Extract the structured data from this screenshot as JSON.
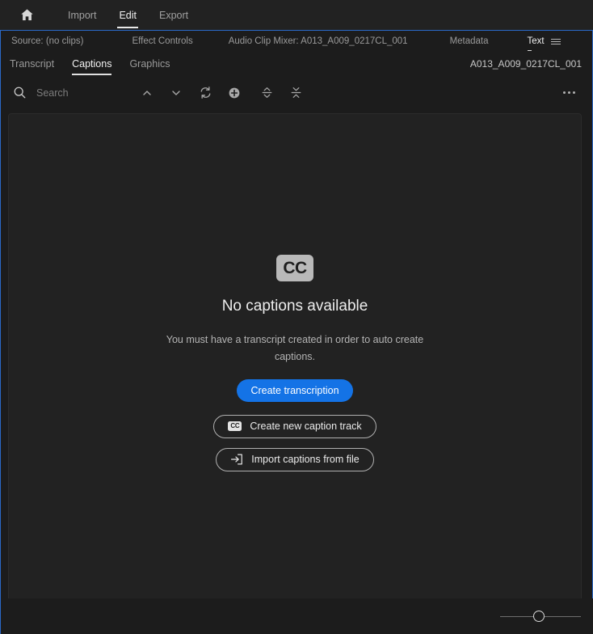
{
  "header": {
    "home_icon": "home-icon",
    "tabs": [
      {
        "label": "Import",
        "active": false
      },
      {
        "label": "Edit",
        "active": true
      },
      {
        "label": "Export",
        "active": false
      }
    ]
  },
  "panel_tabs": [
    {
      "label": "Source: (no clips)",
      "active": false
    },
    {
      "label": "Effect Controls",
      "active": false
    },
    {
      "label": "Audio Clip Mixer: A013_A009_0217CL_001",
      "active": false
    },
    {
      "label": "Metadata",
      "active": false
    },
    {
      "label": "Text",
      "active": true
    }
  ],
  "panel_menu_icon": "hamburger-menu-icon",
  "sub_tabs": [
    {
      "label": "Transcript",
      "active": false
    },
    {
      "label": "Captions",
      "active": true
    },
    {
      "label": "Graphics",
      "active": false
    }
  ],
  "clip_name": "A013_A009_0217CL_001",
  "toolbar": {
    "search_icon": "search-icon",
    "search_placeholder": "Search",
    "search_value": "",
    "prev_icon": "chevron-up-icon",
    "next_icon": "chevron-down-icon",
    "sync_icon": "refresh-icon",
    "add_icon": "plus-circle-icon",
    "split_icon": "split-captions-icon",
    "merge_icon": "merge-captions-icon",
    "more_icon": "more-options-icon"
  },
  "empty_state": {
    "badge_label": "CC",
    "title": "No captions available",
    "description": "You must have a transcript created in order to auto create captions.",
    "primary_button": "Create transcription",
    "secondary_buttons": [
      {
        "label": "Create new caption track",
        "icon": "cc-badge-icon",
        "badge_label": "CC"
      },
      {
        "label": "Import captions from file",
        "icon": "import-arrow-icon"
      }
    ]
  },
  "bottom": {
    "zoom_slider": "zoom-slider",
    "zoom_value": 50
  },
  "colors": {
    "accent_blue": "#1473e6",
    "panel_border_blue": "#2a69c8",
    "app_bg": "#1c1c1c",
    "content_bg": "#222222",
    "text_primary": "#f0f0f0",
    "text_muted": "#9a9a9a"
  }
}
